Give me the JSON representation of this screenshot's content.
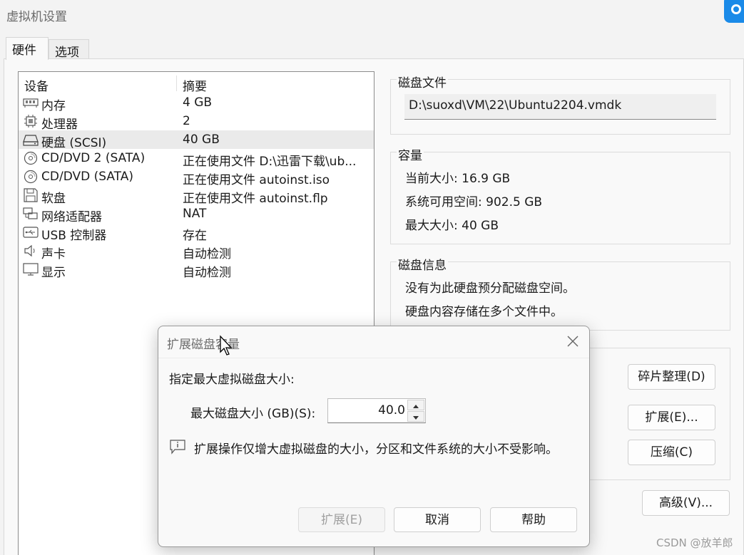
{
  "window": {
    "title": "虚拟机设置"
  },
  "tabs": [
    {
      "label": "硬件",
      "active": true
    },
    {
      "label": "选项",
      "active": false
    }
  ],
  "device_list": {
    "headers": {
      "device": "设备",
      "summary": "摘要"
    },
    "rows": [
      {
        "icon": "memory-icon",
        "name": "内存",
        "summary": "4 GB"
      },
      {
        "icon": "cpu-icon",
        "name": "处理器",
        "summary": "2"
      },
      {
        "icon": "hard-disk-icon",
        "name": "硬盘 (SCSI)",
        "summary": "40 GB",
        "selected": true
      },
      {
        "icon": "cd-dvd-icon",
        "name": "CD/DVD 2 (SATA)",
        "summary": "正在使用文件 D:\\迅雷下载\\ub..."
      },
      {
        "icon": "cd-dvd-icon",
        "name": "CD/DVD (SATA)",
        "summary": "正在使用文件 autoinst.iso"
      },
      {
        "icon": "floppy-icon",
        "name": "软盘",
        "summary": "正在使用文件 autoinst.flp"
      },
      {
        "icon": "network-adapter-icon",
        "name": "网络适配器",
        "summary": "NAT"
      },
      {
        "icon": "usb-icon",
        "name": "USB 控制器",
        "summary": "存在"
      },
      {
        "icon": "speaker-icon",
        "name": "声卡",
        "summary": "自动检测"
      },
      {
        "icon": "monitor-icon",
        "name": "显示",
        "summary": "自动检测"
      }
    ]
  },
  "disk_file": {
    "title": "磁盘文件",
    "path": "D:\\suoxd\\VM\\22\\Ubuntu2204.vmdk"
  },
  "capacity": {
    "title": "容量",
    "current_size": "当前大小: 16.9 GB",
    "available_space": "系统可用空间: 902.5 GB",
    "max_size": "最大大小: 40 GB"
  },
  "disk_info": {
    "title": "磁盘信息",
    "line1": "没有为此硬盘预分配磁盘空间。",
    "line2": "硬盘内容存储在多个文件中。"
  },
  "utilities": {
    "defragment": "碎片整理(D)",
    "expand": "扩展(E)...",
    "compact": "压缩(C)",
    "advanced": "高级(V)..."
  },
  "dialog": {
    "title": "扩展磁盘容量",
    "heading": "指定最大虚拟磁盘大小:",
    "size_label": "最大磁盘大小 (GB)(S):",
    "size_value": "40.0",
    "info": "扩展操作仅增大虚拟磁盘的大小，分区和文件系统的大小不受影响。",
    "expand_button": "扩展(E)",
    "cancel_button": "取消",
    "help_button": "帮助"
  },
  "watermark": "CSDN @放羊郎",
  "colors": {
    "accent": "#1a8ae8",
    "selected_row": "#eaeaea",
    "dialog_bg": "#f9f9f9"
  }
}
